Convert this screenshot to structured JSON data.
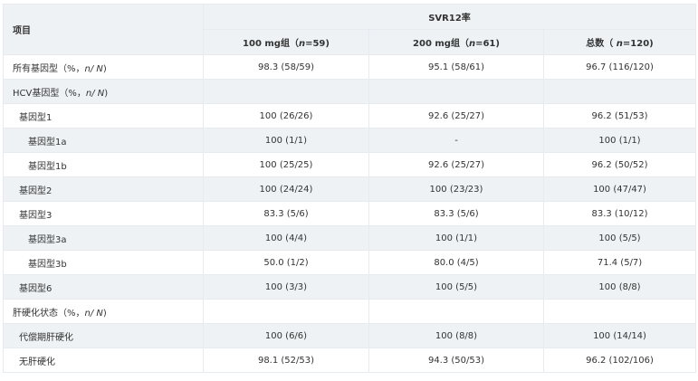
{
  "header": {
    "item_label": "项目",
    "svr_label": "SVR12率",
    "cols": [
      {
        "pre": "100 mg组（",
        "n": "n",
        "post": "=59)"
      },
      {
        "pre": "200 mg组（",
        "n": "n",
        "post": "=61)"
      },
      {
        "pre": "总数（ ",
        "n": "n",
        "post": "=120)"
      }
    ]
  },
  "rows": [
    {
      "label": "所有基因型（%，",
      "ital": "n/ N",
      "close": ")",
      "level": 0,
      "values": [
        "98.3 (58/59)",
        "95.1 (58/61)",
        "96.7 (116/120)"
      ]
    },
    {
      "label": "HCV基因型（%，",
      "ital": "n/ N",
      "close": ")",
      "level": 0,
      "values": [
        "",
        "",
        ""
      ]
    },
    {
      "label": "基因型1",
      "ital": "",
      "close": "",
      "level": 1,
      "values": [
        "100 (26/26)",
        "92.6 (25/27)",
        "96.2 (51/53)"
      ]
    },
    {
      "label": "基因型1a",
      "ital": "",
      "close": "",
      "level": 2,
      "values": [
        "100 (1/1)",
        "-",
        "100 (1/1)"
      ]
    },
    {
      "label": "基因型1b",
      "ital": "",
      "close": "",
      "level": 2,
      "values": [
        "100 (25/25)",
        "92.6 (25/27)",
        "96.2 (50/52)"
      ]
    },
    {
      "label": "基因型2",
      "ital": "",
      "close": "",
      "level": 1,
      "values": [
        "100 (24/24)",
        "100 (23/23)",
        "100 (47/47)"
      ]
    },
    {
      "label": "基因型3",
      "ital": "",
      "close": "",
      "level": 1,
      "values": [
        "83.3 (5/6)",
        "83.3 (5/6)",
        "83.3 (10/12)"
      ]
    },
    {
      "label": "基因型3a",
      "ital": "",
      "close": "",
      "level": 2,
      "values": [
        "100 (4/4)",
        "100 (1/1)",
        "100 (5/5)"
      ]
    },
    {
      "label": "基因型3b",
      "ital": "",
      "close": "",
      "level": 2,
      "values": [
        "50.0 (1/2)",
        "80.0 (4/5)",
        "71.4 (5/7)"
      ]
    },
    {
      "label": "基因型6",
      "ital": "",
      "close": "",
      "level": 1,
      "values": [
        "100 (3/3)",
        "100 (5/5)",
        "100 (8/8)"
      ]
    },
    {
      "label": "肝硬化状态（%，",
      "ital": "n/ N",
      "close": ")",
      "level": 0,
      "values": [
        "",
        "",
        ""
      ]
    },
    {
      "label": "代偿期肝硬化",
      "ital": "",
      "close": "",
      "level": 1,
      "values": [
        "100 (6/6)",
        "100 (8/8)",
        "100 (14/14)"
      ]
    },
    {
      "label": "无肝硬化",
      "ital": "",
      "close": "",
      "level": 1,
      "values": [
        "98.1 (52/53)",
        "94.3 (50/53)",
        "96.2 (102/106)"
      ]
    }
  ]
}
